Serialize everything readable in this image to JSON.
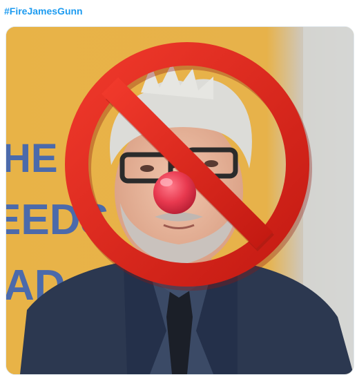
{
  "tweet": {
    "hashtag": "#FireJamesGunn",
    "hashtag_color": "#1d9bf0"
  },
  "media": {
    "description_icon": "prohibition-sign-icon",
    "prohibition_color": "#e1261c",
    "clown_nose_color": "#e8394f",
    "background_color": "#e2ac3c",
    "backdrop_text_color": "#3b63b6",
    "backdrop_text": [
      "HE",
      "EEDS",
      "AD"
    ]
  }
}
